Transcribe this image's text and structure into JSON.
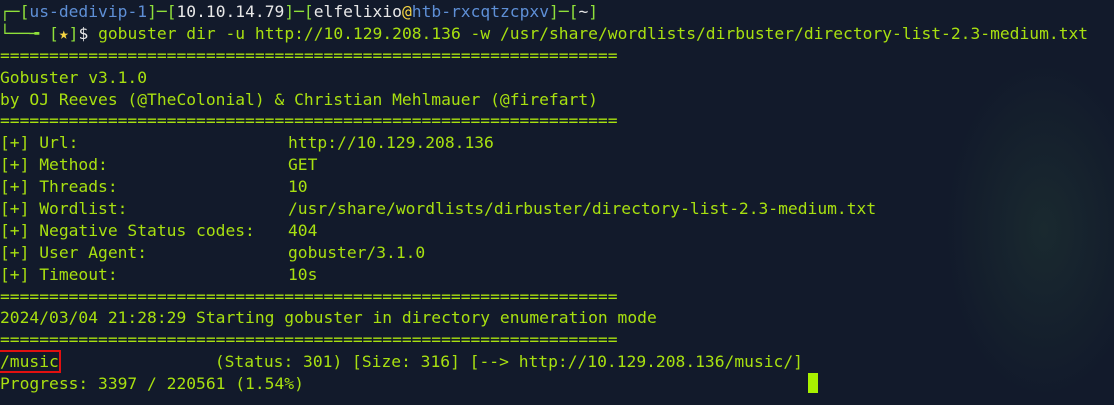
{
  "prompt": {
    "server": "us-dedivip-1",
    "ip": "10.10.14.79",
    "user": "elfelixio",
    "host": "htb-rxcqtzcpxv",
    "cwd": "~",
    "star": "★",
    "symbol": "$",
    "command": "gobuster dir -u http://10.129.208.136 -w /usr/share/wordlists/dirbuster/directory-list-2.3-medium.txt"
  },
  "separator": "===============================================================",
  "banner": {
    "version": "Gobuster v3.1.0",
    "authors": "by OJ Reeves (@TheColonial) & Christian Mehlmauer (@firefart)"
  },
  "config": [
    {
      "key": "[+] Url:",
      "value": "http://10.129.208.136"
    },
    {
      "key": "[+] Method:",
      "value": "GET"
    },
    {
      "key": "[+] Threads:",
      "value": "10"
    },
    {
      "key": "[+] Wordlist:",
      "value": "/usr/share/wordlists/dirbuster/directory-list-2.3-medium.txt"
    },
    {
      "key": "[+] Negative Status codes:",
      "value": "404"
    },
    {
      "key": "[+] User Agent:",
      "value": "gobuster/3.1.0"
    },
    {
      "key": "[+] Timeout:",
      "value": "10s"
    }
  ],
  "start_message": "2024/03/04 21:28:29 Starting gobuster in directory enumeration mode",
  "result": {
    "path": "/music",
    "details": "(Status: 301) [Size: 316] [--> http://10.129.208.136/music/]"
  },
  "progress": "Progress: 3397 / 220561 (1.54%)",
  "colors": {
    "background": "#121a2b",
    "text": "#a8e010",
    "highlight_box": "#e01010"
  }
}
